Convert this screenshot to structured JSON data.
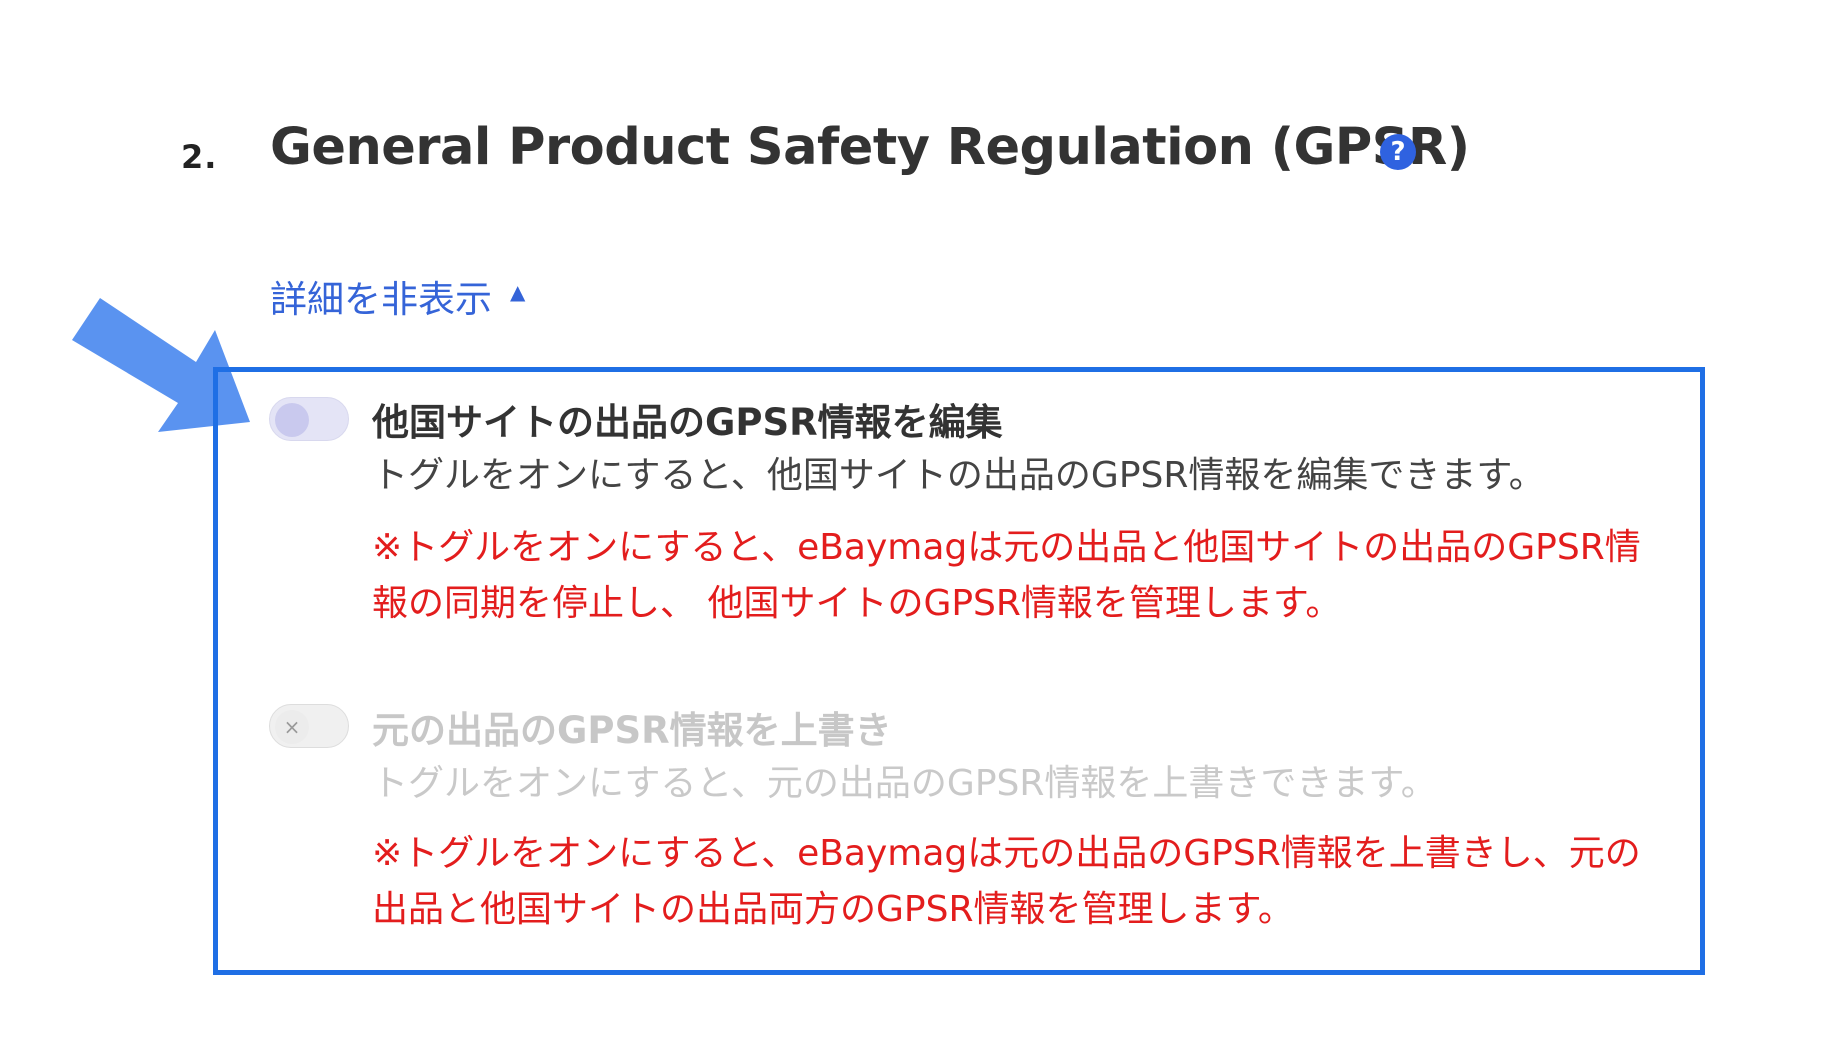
{
  "section": {
    "number": "2.",
    "title": "General Product Safety Regulation (GPSR)",
    "help_icon": "question-circle-icon",
    "help_symbol": "?"
  },
  "details": {
    "label": "詳細を非表示",
    "caret": "▲"
  },
  "settings": [
    {
      "title": "他国サイトの出品のGPSR情報を編集",
      "description": "トグルをオンにすると、他国サイトの出品のGPSR情報を編集できます。",
      "note": "※トグルをオンにすると、eBaymagは元の出品と他国サイトの出品のGPSR情報の同期を停止し、 他国サイトのGPSR情報を管理します。",
      "enabled": true,
      "checked": false
    },
    {
      "title": "元の出品のGPSR情報を上書き",
      "description": "トグルをオンにすると、元の出品のGPSR情報を上書きできます。",
      "note": "※トグルをオンにすると、eBaymagは元の出品のGPSR情報を上書きし、元の出品と他国サイトの出品両方のGPSR情報を管理します。",
      "enabled": false,
      "checked": false,
      "knob_symbol": "×"
    }
  ],
  "colors": {
    "highlight_border": "#1f6fe5",
    "arrow": "#5a93f0",
    "link": "#3564d8",
    "warning": "#e31d1d"
  }
}
